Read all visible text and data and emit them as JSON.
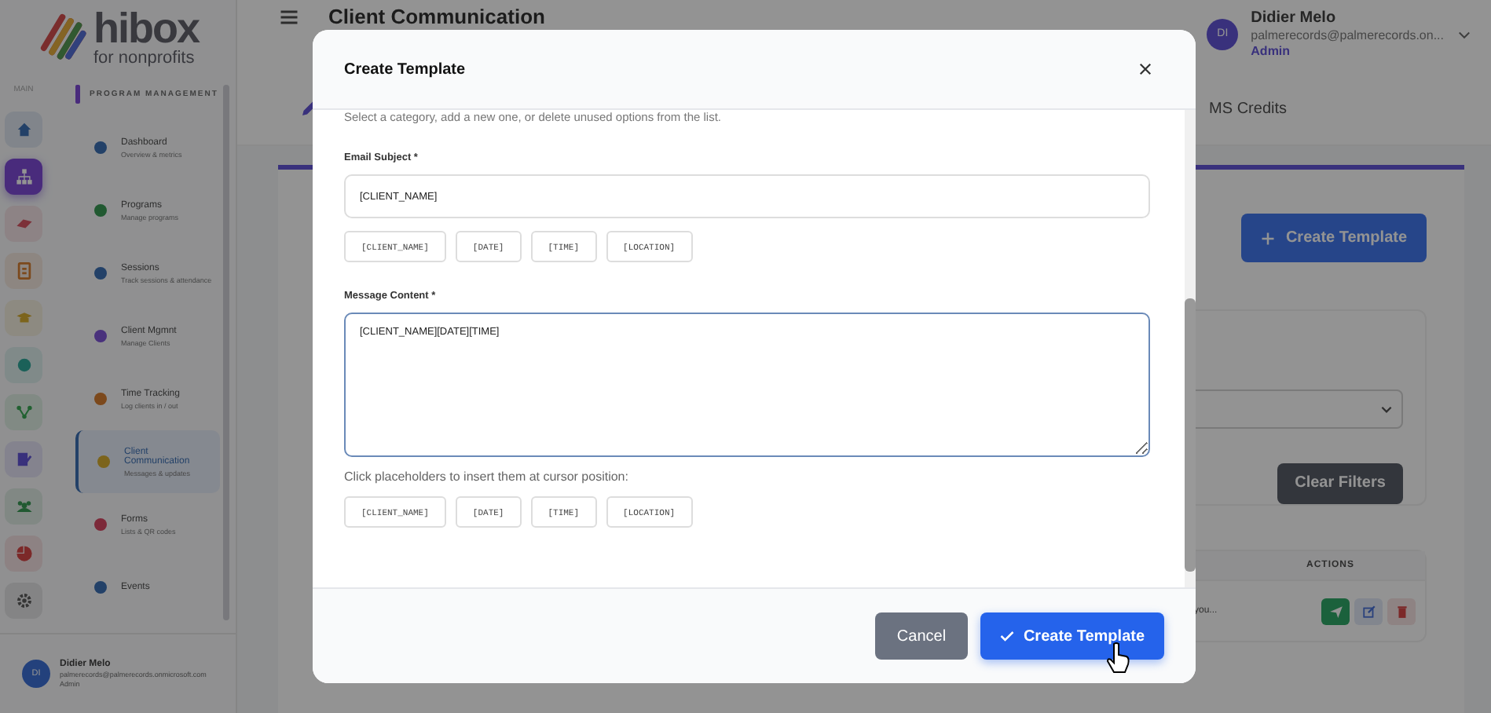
{
  "logo": {
    "name": "hibox",
    "tagline": "for nonprofits"
  },
  "rail": {
    "label": "MAIN",
    "items": [
      {
        "selected": false
      },
      {
        "selected": true
      },
      {
        "selected": false
      },
      {
        "selected": false
      },
      {
        "selected": false
      },
      {
        "selected": false
      },
      {
        "selected": false
      },
      {
        "selected": false
      },
      {
        "selected": false
      },
      {
        "selected": false
      },
      {
        "selected": false
      }
    ]
  },
  "nav": {
    "section": "PROGRAM MANAGEMENT",
    "items": [
      {
        "title": "Dashboard",
        "subtitle": "Overview & metrics",
        "selected": false
      },
      {
        "title": "Programs",
        "subtitle": "Manage programs",
        "selected": false
      },
      {
        "title": "Sessions",
        "subtitle": "Track sessions & attendance",
        "selected": false
      },
      {
        "title": "Client Mgmnt",
        "subtitle": "Manage Clients",
        "selected": false
      },
      {
        "title": "Time Tracking",
        "subtitle": "Log clients in / out",
        "selected": false
      },
      {
        "title": "Client Communication",
        "subtitle": "Messages & updates",
        "selected": true
      },
      {
        "title": "Forms",
        "subtitle": "Lists & QR codes",
        "selected": false
      },
      {
        "title": "Events",
        "selected": false
      }
    ]
  },
  "sidebar_user": {
    "name": "Didier Melo",
    "email": "palmerecords@palmerecords.onmicrosoft.com",
    "role": "Admin",
    "initials": "DI"
  },
  "page": {
    "title": "Client Communication",
    "user": {
      "initials": "DI",
      "name": "Didier Melo",
      "email": "palmerecords@palmerecords.on...",
      "role": "Admin"
    },
    "tab": "MS Credits",
    "create_button": "Create Template",
    "clear_button": "Clear Filters",
    "table": {
      "columns": [
        "ACTIONS"
      ],
      "rows": [
        {
          "cell": "you..."
        }
      ]
    }
  },
  "modal": {
    "title": "Create Template",
    "description": "Select a category, add a new one, or delete unused options from the list.",
    "subject": {
      "label": "Email Subject *",
      "value": "[CLIENT_NAME]"
    },
    "subject_placeholders": [
      "[CLIENT_NAME]",
      "[DATE]",
      "[TIME]",
      "[LOCATION]"
    ],
    "content": {
      "label": "Message Content *",
      "value": "[CLIENT_NAME][DATE][TIME]"
    },
    "hint": "Click placeholders to insert them at cursor position:",
    "content_placeholders": [
      "[CLIENT_NAME]",
      "[DATE]",
      "[TIME]",
      "[LOCATION]"
    ],
    "buttons": [
      {
        "kind": "secondary",
        "label": "Cancel"
      },
      {
        "kind": "primary",
        "label": "Create Template"
      }
    ]
  }
}
